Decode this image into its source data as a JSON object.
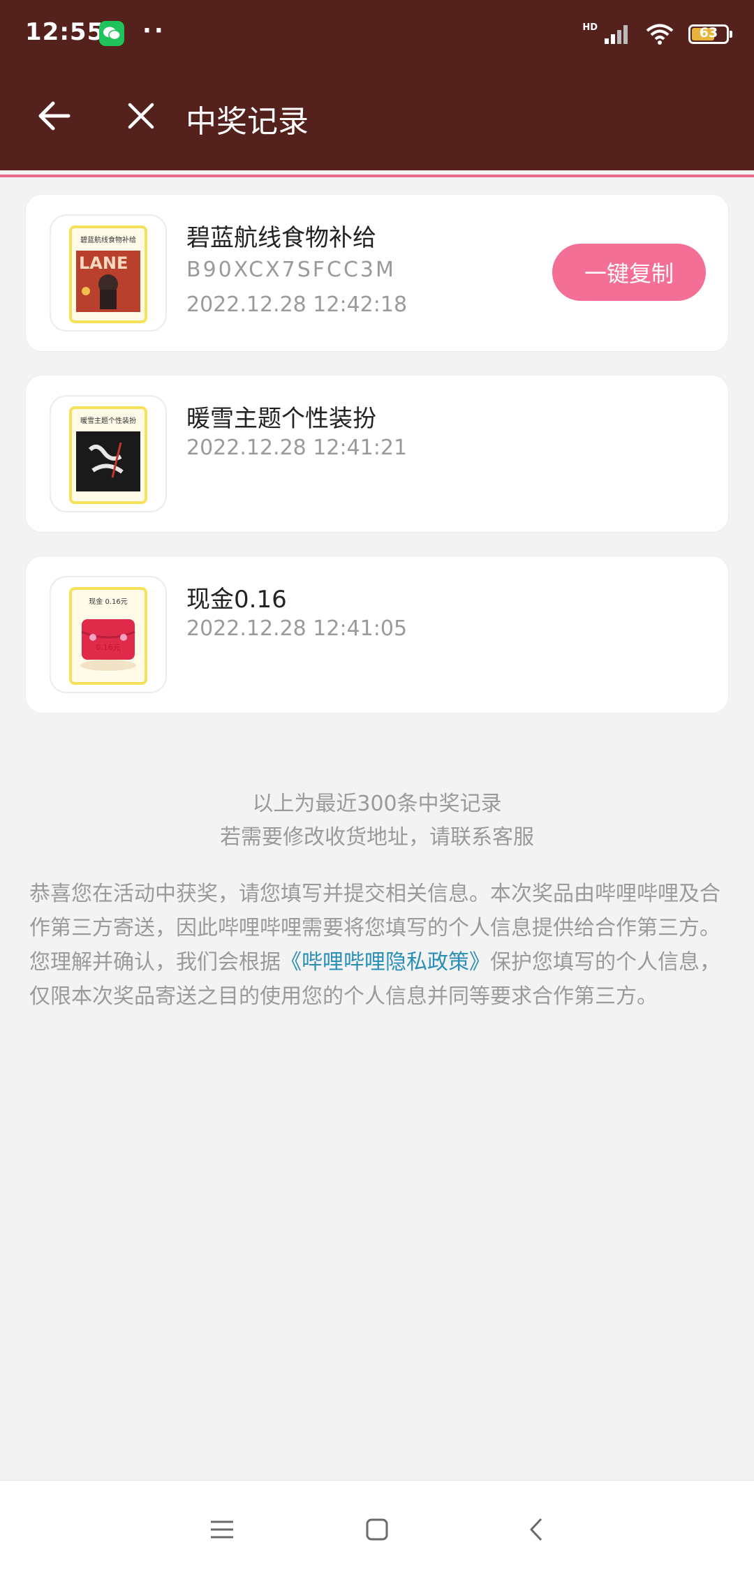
{
  "status_bar": {
    "time": "12:55",
    "network_label": "HD",
    "battery": "63",
    "icons": [
      "wechat-icon",
      "signal-icon",
      "wifi-icon",
      "battery-icon"
    ]
  },
  "header": {
    "title": "中奖记录",
    "back_icon": "arrow-left-icon",
    "close_icon": "close-icon"
  },
  "records": [
    {
      "name": "碧蓝航线食物补给",
      "code": "B90XCX7SFCC3M",
      "time": "2022.12.28 12:42:18",
      "action_label": "一键复制",
      "thumb_label": "碧蓝航线食物补给",
      "thumb_icon": "game-poster-icon"
    },
    {
      "name": "暖雪主题个性装扮",
      "time": "2022.12.28 12:41:21",
      "thumb_label": "暖雪主题个性装扮",
      "thumb_icon": "theme-poster-icon"
    },
    {
      "name": "现金0.16",
      "time": "2022.12.28 12:41:05",
      "thumb_label": "现金 0.16元",
      "thumb_icon": "red-envelope-icon",
      "thumb_sublabel": "0.16元"
    }
  ],
  "notes": {
    "line1": "以上为最近300条中奖记录",
    "line2": "若需要修改收货地址，请联系客服"
  },
  "disclaimer": {
    "para1": "恭喜您在活动中获奖，请您填写并提交相关信息。本次奖品由哔哩哔哩及合作第三方寄送，因此哔哩哔哩需要将您填写的个人信息提供给合作第三方。",
    "para2_before": "您理解并确认，我们会根据",
    "para2_link": "《哔哩哔哩隐私政策》",
    "para2_after": "保护您填写的个人信息，仅限本次奖品寄送之目的使用您的个人信息并同等要求合作第三方。"
  },
  "system_nav": [
    "menu-icon",
    "home-icon",
    "back-icon"
  ],
  "colors": {
    "header_bg": "#54211c",
    "accent_pink": "#f46f95",
    "link_blue": "#2a8fb7"
  }
}
